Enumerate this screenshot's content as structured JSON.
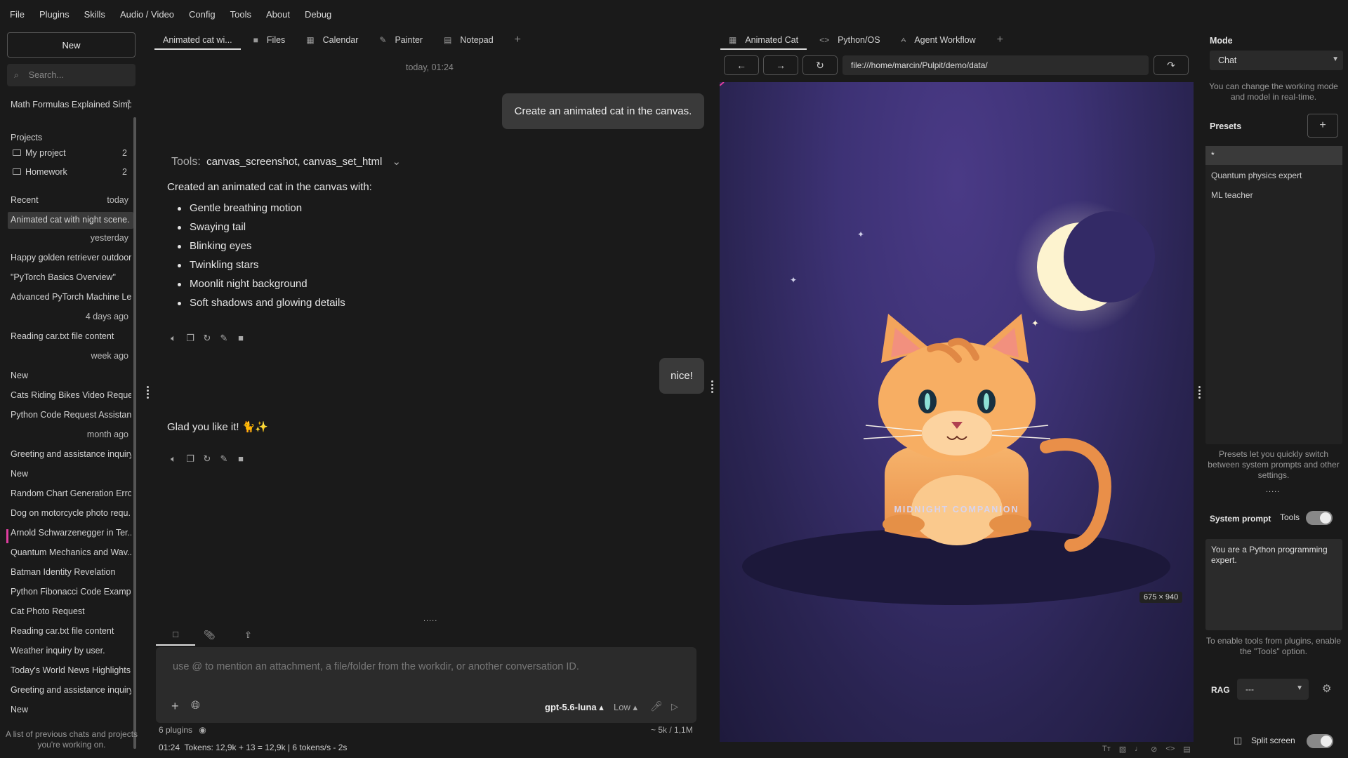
{
  "menu": [
    "File",
    "Plugins",
    "Skills",
    "Audio / Video",
    "Config",
    "Tools",
    "About",
    "Debug"
  ],
  "sidebar": {
    "new_label": "New",
    "search_placeholder": "Search...",
    "pinned": "Math Formulas Explained Simply",
    "projects_title": "Projects",
    "projects": [
      {
        "name": "My project",
        "count": "2"
      },
      {
        "name": "Homework",
        "count": "2"
      }
    ],
    "recent_title": "Recent",
    "groups": [
      {
        "date": "today",
        "items": [
          "Animated cat with night scene."
        ]
      },
      {
        "date": "yesterday",
        "items": [
          "Happy golden retriever outdoors",
          "\"PyTorch Basics Overview\"",
          "Advanced PyTorch Machine Le..."
        ]
      },
      {
        "date": "4 days ago",
        "items": [
          "Reading car.txt file content"
        ]
      },
      {
        "date": "week ago",
        "items": [
          "New",
          "Cats Riding Bikes Video Request",
          "Python Code Request Assistan..."
        ]
      },
      {
        "date": "month ago",
        "items": [
          "Greeting and assistance inquiry.",
          "New",
          "Random Chart Generation Error",
          "Dog on motorcycle photo requ...",
          "Arnold Schwarzenegger in Ter...",
          "Quantum Mechanics and Wav...",
          "Batman Identity Revelation",
          "Python Fibonacci Code Example",
          "Cat Photo Request",
          "Reading car.txt file content",
          "Weather inquiry by user.",
          "Today's World News Highlights",
          "Greeting and assistance inquiry.",
          "New"
        ]
      }
    ],
    "footer": "A list of previous chats and projects you're working on."
  },
  "chat": {
    "tabs": [
      "Animated cat wi...",
      "Files",
      "Calendar",
      "Painter",
      "Notepad"
    ],
    "timestamp": "today, 01:24",
    "user_msg_1": "Create an animated cat in the canvas.",
    "tools_label": "Tools:",
    "tools_value": "canvas_screenshot, canvas_set_html",
    "reply_intro": "Created an animated cat in the canvas with:",
    "bullets": [
      "Gentle breathing motion",
      "Swaying tail",
      "Blinking eyes",
      "Twinkling stars",
      "Moonlit night background",
      "Soft shadows and glowing details"
    ],
    "user_msg_2": "nice!",
    "reply_2": "Glad you like it! 🐈✨",
    "input_placeholder": "use @ to mention an attachment, a file/folder from the workdir, or another conversation ID.",
    "model": "gpt-5.6-luna ▴",
    "effort": "Low ▴",
    "plugins": "6 plugins",
    "context": "~ 5k / 1,1M",
    "status": "01:24  Tokens: 12,9k + 13 = 12,9k | 6 tokens/s - 2s"
  },
  "browser": {
    "tabs": [
      "Animated Cat",
      "Python/OS",
      "Agent Workflow"
    ],
    "url": "file:///home/marcin/Pulpit/demo/data/",
    "canvas_title": "MIDNIGHT COMPANION",
    "canvas_size": "675 × 940"
  },
  "right": {
    "mode_label": "Mode",
    "mode_value": "Chat",
    "mode_note": "You can change the working mode and model in real-time.",
    "presets_label": "Presets",
    "presets": [
      "*",
      "Quantum physics expert",
      "ML teacher"
    ],
    "presets_note": "Presets let you quickly switch between system prompts and other settings.",
    "system_prompt_label": "System prompt",
    "tools_label": "Tools",
    "system_prompt": "You are a Python programming expert.",
    "tools_note": "To enable tools from plugins, enable the \"Tools\" option.",
    "rag_label": "RAG",
    "rag_value": "---",
    "split_label": "Split screen"
  },
  "colors": {
    "bg": "#1a1a1a",
    "panel": "#2b2b2b",
    "accent_pink": "#e03ea0",
    "canvas_purple": "#3d3275",
    "cat_orange": "#f0a050",
    "moon": "#fdf3cf"
  }
}
